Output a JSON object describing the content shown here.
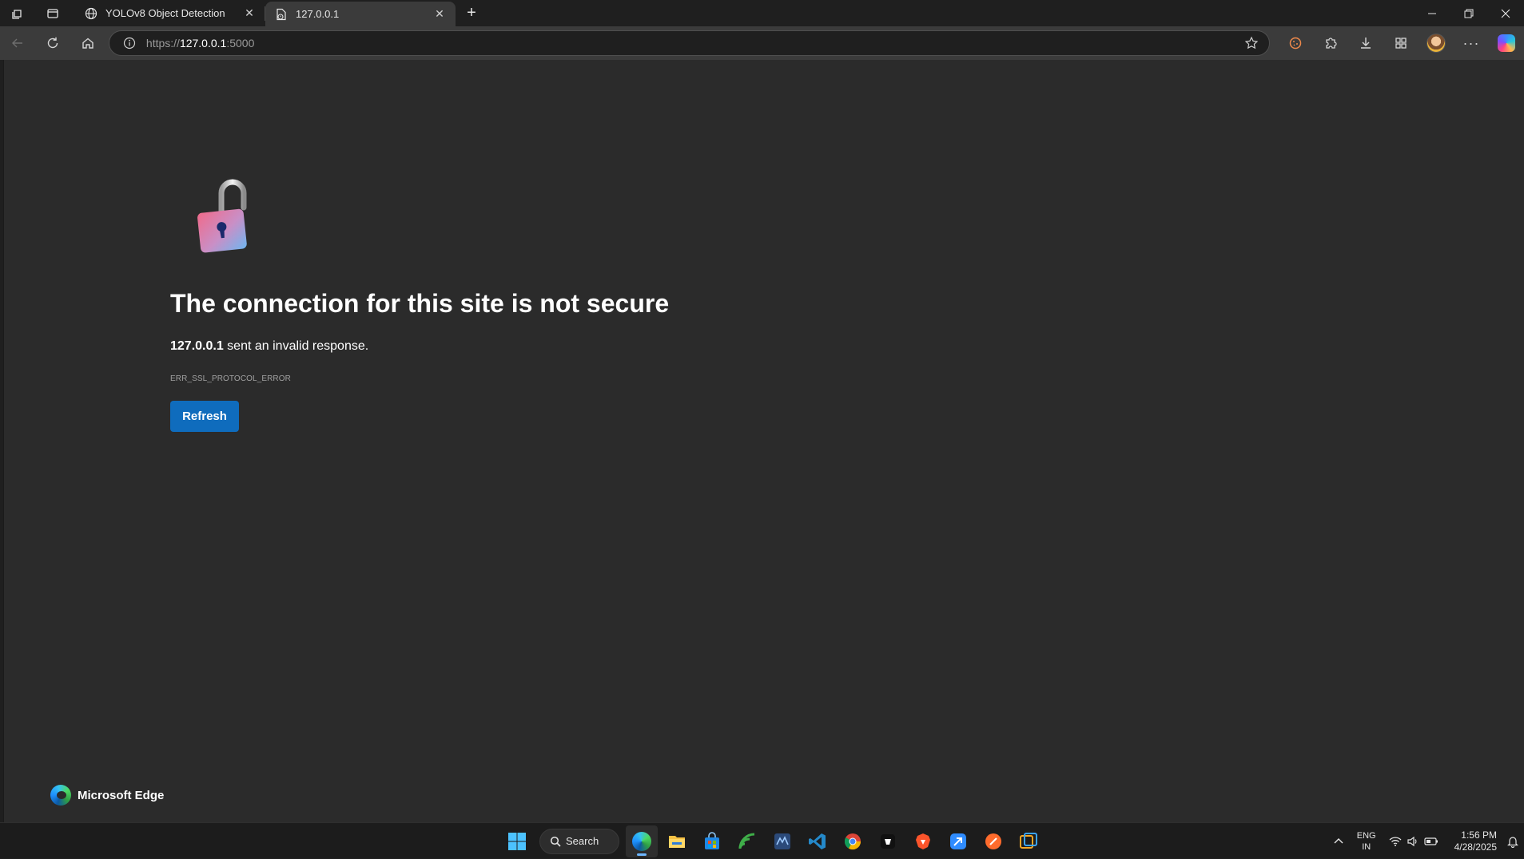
{
  "tabs": [
    {
      "title": "YOLOv8 Object Detection",
      "icon": "globe-icon",
      "active": false
    },
    {
      "title": "127.0.0.1",
      "icon": "page-warning-icon",
      "active": true
    }
  ],
  "address": {
    "scheme": "https://",
    "host": "127.0.0.1",
    "port": ":5000"
  },
  "error": {
    "title": "The connection for this site is not secure",
    "host": "127.0.0.1",
    "message": " sent an invalid response.",
    "code": "ERR_SSL_PROTOCOL_ERROR",
    "button_label": "Refresh"
  },
  "brand": {
    "name": "Microsoft Edge"
  },
  "taskbar": {
    "search_label": "Search",
    "apps": [
      "start-icon",
      "edge-icon",
      "file-explorer-icon",
      "store-icon",
      "app-green-icon",
      "app-blue-icon",
      "vscode-icon",
      "chrome-icon",
      "app-dark-icon",
      "brave-icon",
      "app-arrow-icon",
      "app-orange-icon",
      "app-box-icon"
    ]
  },
  "tray": {
    "lang_line1": "ENG",
    "lang_line2": "IN",
    "time": "1:56 PM",
    "date": "4/28/2025"
  },
  "colors": {
    "accent_button": "#0f6cbd",
    "page_bg": "#2b2b2b",
    "chrome_bg": "#1f1f1f"
  }
}
